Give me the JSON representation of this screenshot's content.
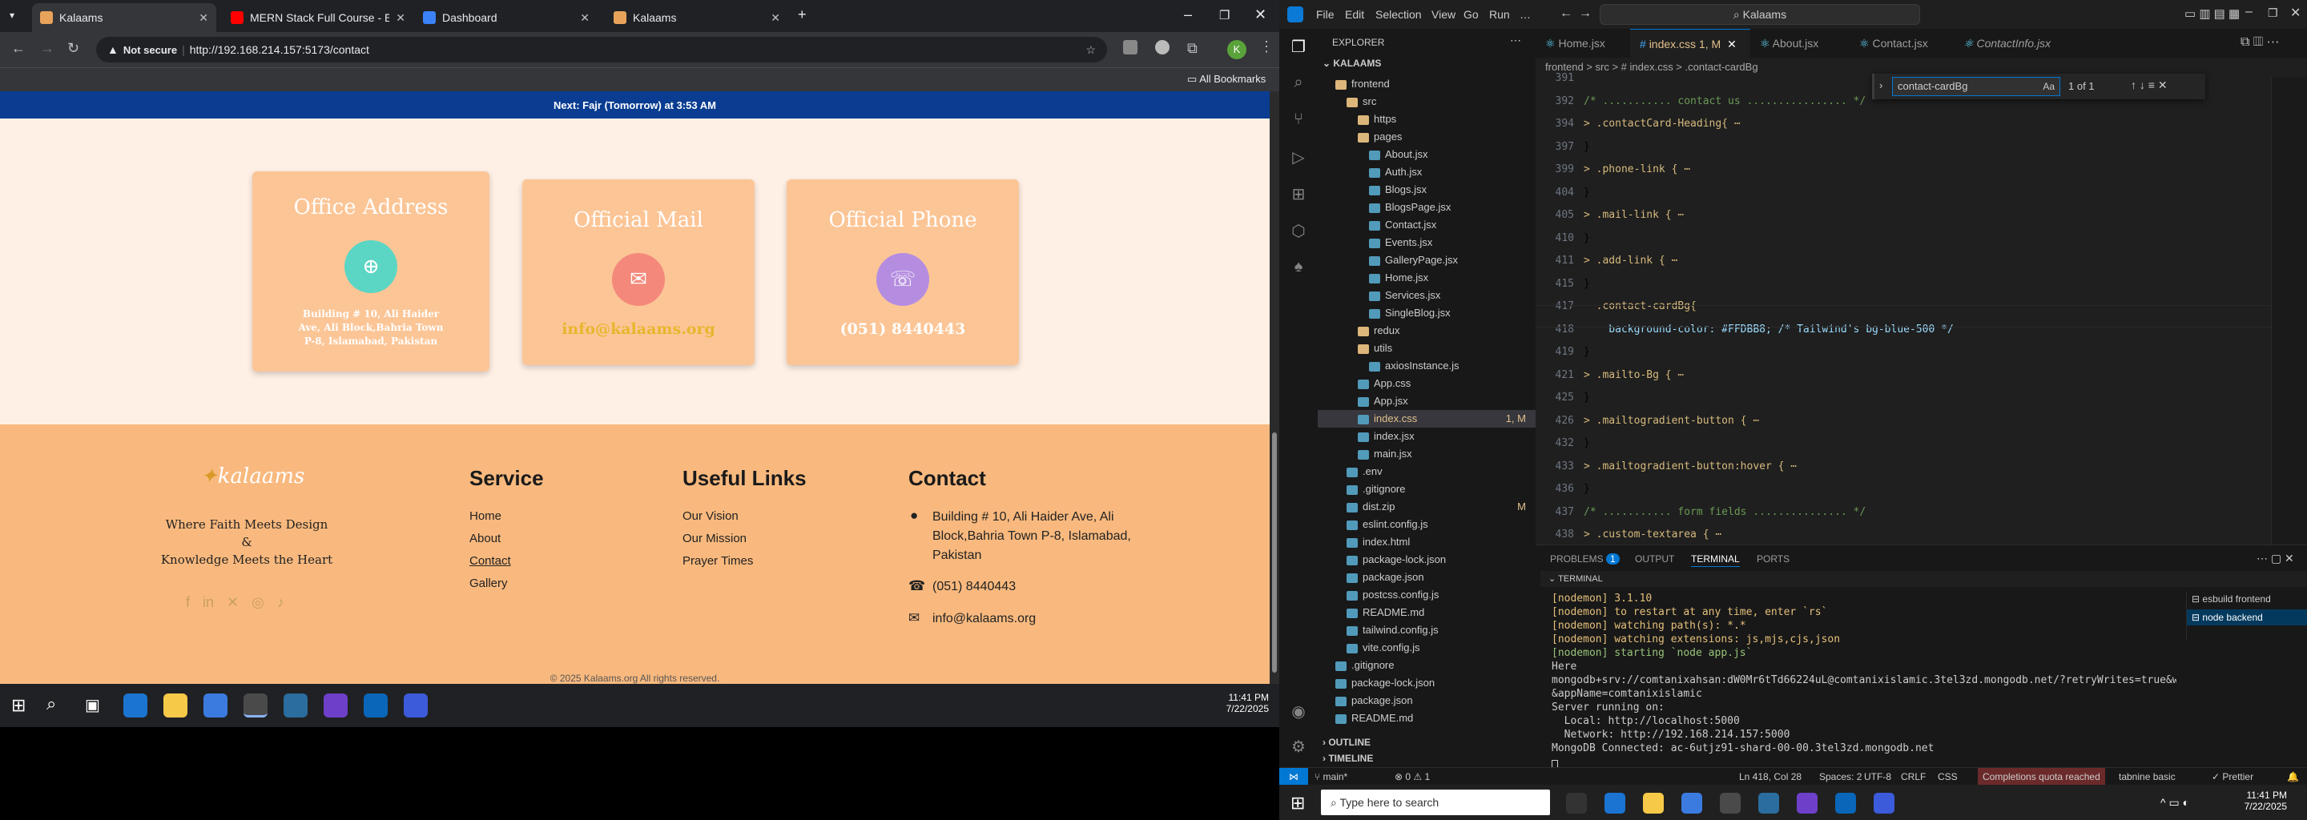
{
  "browser": {
    "tabs": [
      {
        "title": "Kalaams",
        "fav": "#e8a35a",
        "active": true
      },
      {
        "title": "MERN Stack Full Course - ECom",
        "fav": "#ff0000"
      },
      {
        "title": "Dashboard",
        "fav": "#3b82f6"
      },
      {
        "title": "Kalaams",
        "fav": "#e8a35a"
      }
    ],
    "not_secure": "Not secure",
    "url": "http://192.168.214.157:5173/contact",
    "all_bookmarks": "All Bookmarks"
  },
  "site": {
    "prayer_bar": "Next: Fajr (Tomorrow) at 3:53 AM",
    "cards": [
      {
        "title": "Office Address",
        "icon": "globe-icon",
        "glyph": "⊕",
        "color": "#5cd6c4",
        "text": "Building # 10, Ali Haider Ave, Ali Block,Bahria Town P-8, Islamabad, Pakistan"
      },
      {
        "title": "Official Mail",
        "icon": "envelope-icon",
        "glyph": "✉",
        "color": "#f4897b",
        "text": "info@kalaams.org"
      },
      {
        "title": "Official Phone",
        "icon": "headset-icon",
        "glyph": "☏",
        "color": "#b58de0",
        "text": "(051) 8440443"
      }
    ],
    "footer": {
      "logo": "kalaams",
      "tagline1": "Where Faith Meets Design",
      "tagline2": "&",
      "tagline3": "Knowledge Meets the Heart",
      "service_title": "Service",
      "service": [
        "Home",
        "About",
        "Contact",
        "Gallery"
      ],
      "useful_title": "Useful Links",
      "useful": [
        "Our Vision",
        "Our Mission",
        "Prayer Times"
      ],
      "contact_title": "Contact",
      "address": "Building # 10, Ali Haider Ave, Ali Block,Bahria Town P-8, Islamabad, Pakistan",
      "phone": "(051) 8440443",
      "email": "info@kalaams.org",
      "copyright": "© 2025 Kalaams.org All rights reserved."
    }
  },
  "left_taskbar": {
    "time": "11:41 PM",
    "date": "7/22/2025"
  },
  "vscode": {
    "menu": [
      "File",
      "Edit",
      "Selection",
      "View",
      "Go",
      "Run",
      "…"
    ],
    "search": "Kalaams",
    "explorer_title": "EXPLORER",
    "root": "KALAAMS",
    "tree": [
      {
        "name": "frontend",
        "lvl": 1,
        "folder": true
      },
      {
        "name": "src",
        "lvl": 2,
        "folder": true
      },
      {
        "name": "https",
        "lvl": 3,
        "folder": true
      },
      {
        "name": "pages",
        "lvl": 3,
        "folder": true
      },
      {
        "name": "About.jsx",
        "lvl": 4
      },
      {
        "name": "Auth.jsx",
        "lvl": 4
      },
      {
        "name": "Blogs.jsx",
        "lvl": 4
      },
      {
        "name": "BlogsPage.jsx",
        "lvl": 4
      },
      {
        "name": "Contact.jsx",
        "lvl": 4
      },
      {
        "name": "Events.jsx",
        "lvl": 4
      },
      {
        "name": "GalleryPage.jsx",
        "lvl": 4
      },
      {
        "name": "Home.jsx",
        "lvl": 4
      },
      {
        "name": "Services.jsx",
        "lvl": 4
      },
      {
        "name": "SingleBlog.jsx",
        "lvl": 4
      },
      {
        "name": "redux",
        "lvl": 3,
        "folder": true
      },
      {
        "name": "utils",
        "lvl": 3,
        "folder": true
      },
      {
        "name": "axiosInstance.js",
        "lvl": 4
      },
      {
        "name": "App.css",
        "lvl": 3
      },
      {
        "name": "App.jsx",
        "lvl": 3
      },
      {
        "name": "index.css",
        "lvl": 3,
        "sel": true,
        "badge": "1, M"
      },
      {
        "name": "index.jsx",
        "lvl": 3
      },
      {
        "name": "main.jsx",
        "lvl": 3
      },
      {
        "name": ".env",
        "lvl": 2
      },
      {
        "name": ".gitignore",
        "lvl": 2
      },
      {
        "name": "dist.zip",
        "lvl": 2,
        "badge": "M"
      },
      {
        "name": "eslint.config.js",
        "lvl": 2
      },
      {
        "name": "index.html",
        "lvl": 2
      },
      {
        "name": "package-lock.json",
        "lvl": 2
      },
      {
        "name": "package.json",
        "lvl": 2
      },
      {
        "name": "postcss.config.js",
        "lvl": 2
      },
      {
        "name": "README.md",
        "lvl": 2
      },
      {
        "name": "tailwind.config.js",
        "lvl": 2
      },
      {
        "name": "vite.config.js",
        "lvl": 2
      },
      {
        "name": ".gitignore",
        "lvl": 1
      },
      {
        "name": "package-lock.json",
        "lvl": 1
      },
      {
        "name": "package.json",
        "lvl": 1
      },
      {
        "name": "README.md",
        "lvl": 1
      }
    ],
    "outline": "OUTLINE",
    "timeline": "TIMELINE",
    "tabs": [
      "Home.jsx",
      "index.css 1, M",
      "About.jsx",
      "Contact.jsx",
      "ContactInfo.jsx"
    ],
    "breadcrumb": "frontend > src > # index.css > .contact-cardBg",
    "find": {
      "query": "contact-cardBg",
      "result": "1 of 1",
      "aa": "Aa"
    },
    "code": [
      {
        "n": "391",
        "t": ""
      },
      {
        "n": "392",
        "t": "/* ........... contact us ................ */",
        "c": "cm"
      },
      {
        "n": "394",
        "t": "> .contactCard-Heading{ ⋯",
        "c": "sel-c"
      },
      {
        "n": "397",
        "t": "}"
      },
      {
        "n": "399",
        "t": "> .phone-link { ⋯",
        "c": "sel-c"
      },
      {
        "n": "404",
        "t": "}"
      },
      {
        "n": "405",
        "t": "> .mail-link { ⋯",
        "c": "sel-c"
      },
      {
        "n": "410",
        "t": "}"
      },
      {
        "n": "411",
        "t": "> .add-link { ⋯",
        "c": "sel-c"
      },
      {
        "n": "415",
        "t": "}"
      },
      {
        "n": "417",
        "t": "  .contact-cardBg{",
        "c": "sel-c"
      },
      {
        "n": "418",
        "t": "    background-color: #FFDBB8; /* Tailwind's bg-blue-500 */",
        "c": "pr"
      },
      {
        "n": "419",
        "t": "}"
      },
      {
        "n": "421",
        "t": "> .mailto-Bg { ⋯",
        "c": "sel-c"
      },
      {
        "n": "425",
        "t": "}"
      },
      {
        "n": "426",
        "t": "> .mailtogradient-button { ⋯",
        "c": "sel-c"
      },
      {
        "n": "432",
        "t": "}"
      },
      {
        "n": "433",
        "t": "> .mailtogradient-button:hover { ⋯",
        "c": "sel-c"
      },
      {
        "n": "436",
        "t": "}"
      },
      {
        "n": "437",
        "t": "/* ........... form fields ............... */",
        "c": "cm"
      },
      {
        "n": "438",
        "t": "> .custom-textarea { ⋯",
        "c": "sel-c"
      }
    ],
    "panel_tabs": [
      "PROBLEMS",
      "OUTPUT",
      "TERMINAL",
      "PORTS"
    ],
    "problems_count": "1",
    "terminal_title": "TERMINAL",
    "terminal": [
      {
        "t": "[nodemon] 3.1.10",
        "c": "#e5c07b"
      },
      {
        "t": "[nodemon] to restart at any time, enter `rs`",
        "c": "#e5c07b"
      },
      {
        "t": "[nodemon] watching path(s): *.*",
        "c": "#e5c07b"
      },
      {
        "t": "[nodemon] watching extensions: js,mjs,cjs,json",
        "c": "#e5c07b"
      },
      {
        "t": "[nodemon] starting `node app.js`",
        "c": "#98c379"
      },
      {
        "t": "Here",
        "c": "#ccc"
      },
      {
        "t": "mongodb+srv://comtanixahsan:dW0Mr6tTd66224uL@comtanixislamic.3tel3zd.mongodb.net/?retryWrites=true&w=majority",
        "c": "#ccc"
      },
      {
        "t": "&appName=comtanixislamic",
        "c": "#ccc"
      },
      {
        "t": "Server running on:",
        "c": "#ccc"
      },
      {
        "t": "  Local: http://localhost:5000",
        "c": "#ccc"
      },
      {
        "t": "  Network: http://192.168.214.157:5000",
        "c": "#ccc"
      },
      {
        "t": "MongoDB Connected: ac-6utjz91-shard-00-00.3tel3zd.mongodb.net",
        "c": "#ccc"
      }
    ],
    "terminals": [
      "esbuild frontend",
      "node backend"
    ],
    "status": {
      "branch": "main*",
      "problems": "⊗ 0 ⚠ 1",
      "position": "Ln 418, Col 28",
      "spaces": "Spaces: 2",
      "encoding": "UTF-8",
      "eol": "CRLF",
      "lang": "CSS",
      "quota": "Completions quota reached",
      "tabnine": "tabnine basic",
      "prettier": "✓ Prettier"
    },
    "taskbar": {
      "search": "Type here to search",
      "time": "11:41 PM",
      "date": "7/22/2025"
    }
  }
}
